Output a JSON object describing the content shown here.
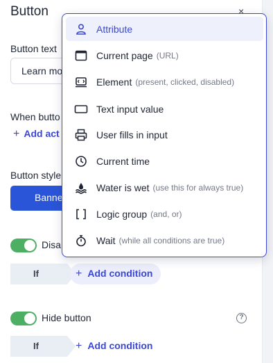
{
  "panel": {
    "title": "Button",
    "close_glyph": "×",
    "button_text_label": "Button text",
    "button_text_value": "Learn mo",
    "when_label": "When butto",
    "add_action_label": "Add act",
    "button_style_label": "Button style",
    "style_button_label": "Banne",
    "disable_toggle_label": "Disa",
    "if_label": "If",
    "add_condition_label": "Add condition",
    "hide_button_label": "Hide button",
    "help_glyph": "?",
    "plus_glyph": "+"
  },
  "menu": {
    "items": [
      {
        "label": "Attribute",
        "hint": "",
        "icon": "person-icon"
      },
      {
        "label": "Current page",
        "hint": "(URL)",
        "icon": "browser-window-icon"
      },
      {
        "label": "Element",
        "hint": "(present, clicked, disabled)",
        "icon": "element-icon"
      },
      {
        "label": "Text input value",
        "hint": "",
        "icon": "text-input-icon"
      },
      {
        "label": "User fills in input",
        "hint": "",
        "icon": "printer-icon"
      },
      {
        "label": "Current time",
        "hint": "",
        "icon": "clock-icon"
      },
      {
        "label": "Water is wet",
        "hint": "(use this for always true)",
        "icon": "water-icon"
      },
      {
        "label": "Logic group",
        "hint": "(and, or)",
        "icon": "brackets-icon"
      },
      {
        "label": "Wait",
        "hint": "(while all conditions are true)",
        "icon": "stopwatch-icon"
      }
    ]
  },
  "colors": {
    "accent": "#3a47d5",
    "toggle_on": "#4caf63",
    "primary_button": "#2b55d8"
  }
}
